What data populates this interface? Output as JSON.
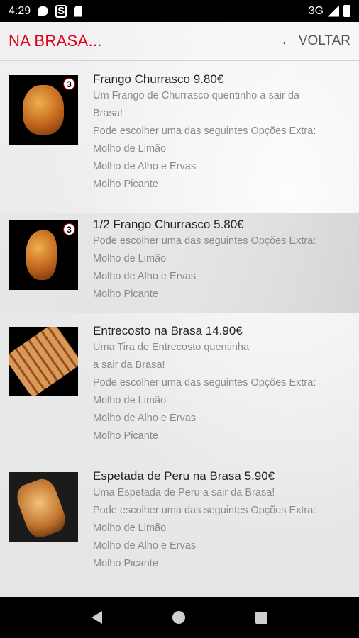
{
  "status_bar": {
    "time": "4:29",
    "network": "3G"
  },
  "app_bar": {
    "title": "NA BRASA...",
    "back_label": "VOLTAR"
  },
  "items": [
    {
      "title": "Frango Churrasco 9.80€",
      "badge": "3",
      "lines": [
        "Um Frango de Churrasco quentinho a sair da",
        "Brasa!",
        "Pode escolher uma das seguintes Opções Extra:",
        "Molho de Limão",
        "Molho de Alho e Ervas",
        "Molho Picante"
      ]
    },
    {
      "title": "1/2 Frango Churrasco 5.80€",
      "badge": "3",
      "lines": [
        "Pode escolher uma das seguintes Opções Extra:",
        "Molho de Limão",
        "Molho de Alho e Ervas",
        "Molho Picante"
      ]
    },
    {
      "title": "Entrecosto na Brasa 14.90€",
      "lines": [
        "Uma Tira de Entrecosto quentinha",
        "a sair da Brasa!",
        "Pode escolher uma das seguintes Opções Extra:",
        "Molho de Limão",
        "Molho de Alho e Ervas",
        "Molho Picante"
      ]
    },
    {
      "title": "Espetada de Peru na Brasa 5.90€",
      "lines": [
        "Uma Espetada de Peru a sair da Brasa!",
        "Pode escolher uma das seguintes Opções Extra:",
        "Molho de Limão",
        "Molho de Alho e Ervas",
        "Molho Picante"
      ]
    }
  ],
  "icons": {
    "back": "arrow-left-icon",
    "nav": [
      "nav-back-icon",
      "nav-home-icon",
      "nav-recents-icon"
    ]
  },
  "colors": {
    "accent": "#e0001b"
  }
}
